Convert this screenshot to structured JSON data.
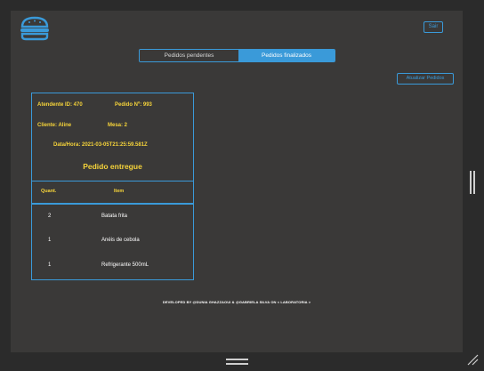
{
  "header": {
    "logout_label": "Sair",
    "logo_icon": "burger-icon"
  },
  "tabs": [
    {
      "label": "Pedidos pendentes",
      "active": false
    },
    {
      "label": "Pedidos finalizados",
      "active": true
    }
  ],
  "toolbar": {
    "refresh_label": "Atualizar Pedidos"
  },
  "order": {
    "attendant": "Atendente ID: 470",
    "order_number": "Pedido Nº: 993",
    "client": "Cliente: Aline",
    "table": "Mesa: 2",
    "datetime": "Data/Hora: 2021-03-05T21:25:59.581Z",
    "status": "Pedido entregue"
  },
  "items": {
    "headers": {
      "qty": "Quant.",
      "item": "Item"
    },
    "rows": [
      {
        "qty": "2",
        "name": "Batata frita"
      },
      {
        "qty": "1",
        "name": "Anéis de cebola"
      },
      {
        "qty": "1",
        "name": "Refrigerante 500mL"
      }
    ]
  },
  "footer": {
    "text": "DEVELOPED BY  @DUNIA GHAZZAOUI  &  @GABRIELA SILVA  ON  < LABORATORIA >"
  },
  "colors": {
    "accent": "#3a9ad9",
    "highlight": "#f5d33a",
    "panel": "#3a3938"
  }
}
